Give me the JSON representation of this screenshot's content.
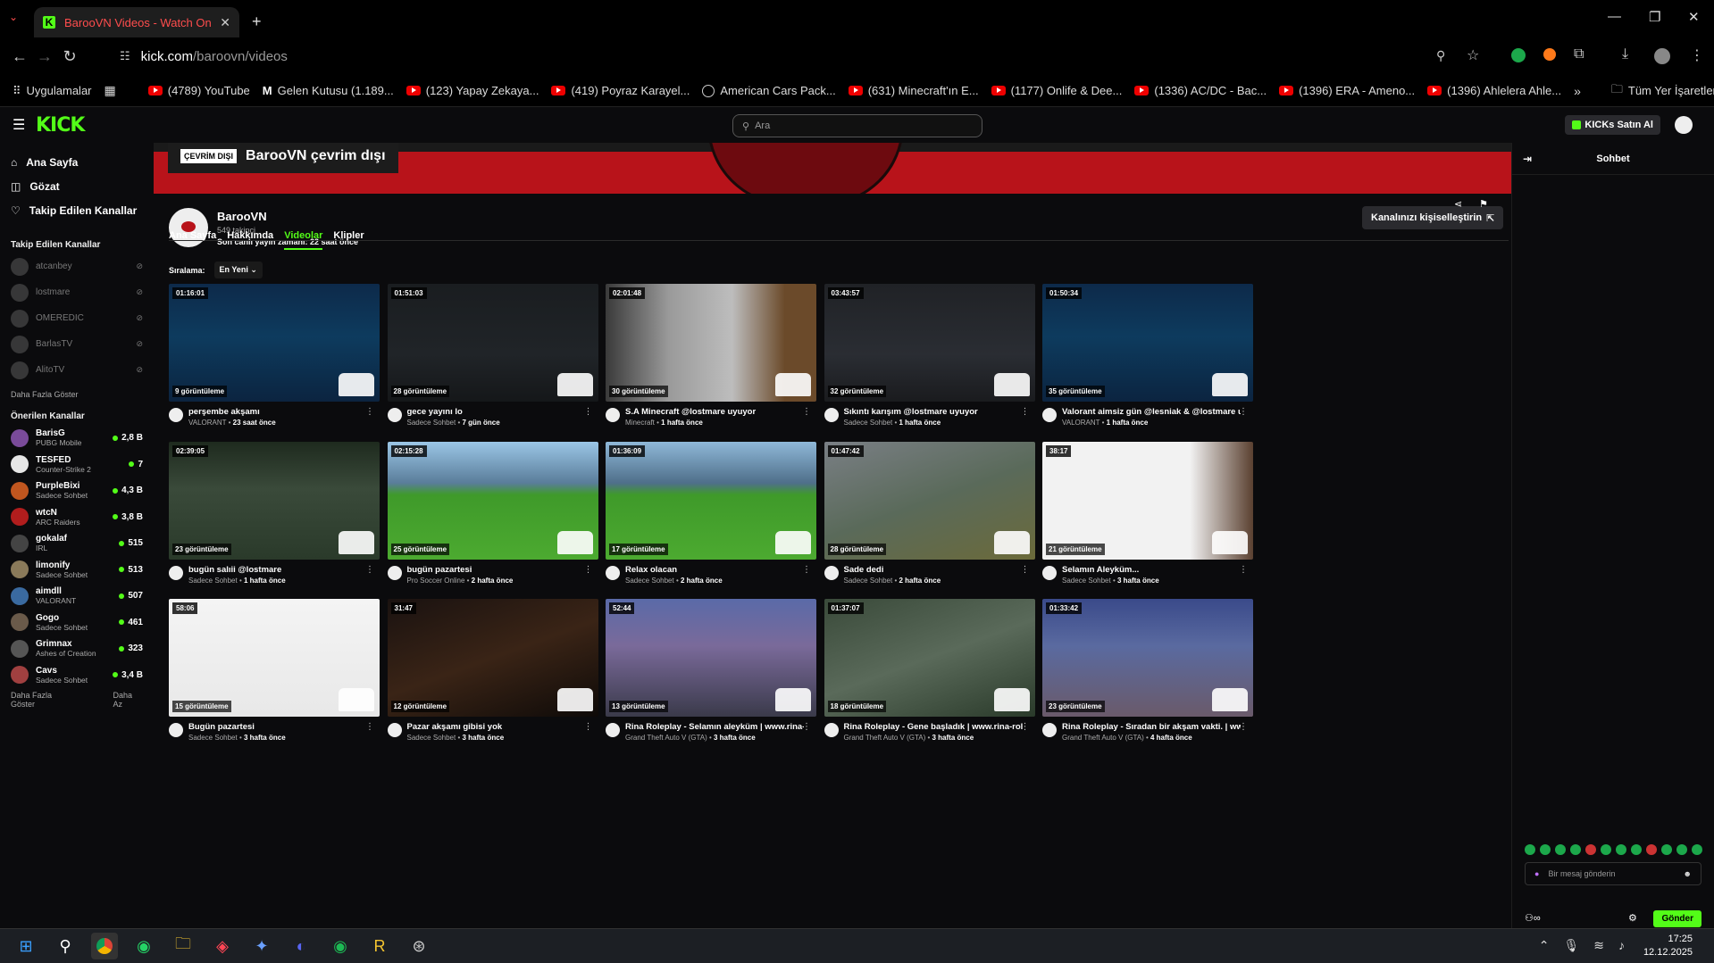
{
  "browser": {
    "tab_title": "BarooVN Videos - Watch On-D",
    "url_host": "kick.com",
    "url_path": "/baroovn/videos",
    "bookmarks": [
      {
        "label": "Uygulamalar",
        "icon": "apps-icon"
      },
      {
        "label": "(4789) YouTube",
        "icon": "youtube-icon"
      },
      {
        "label": "Gelen Kutusu (1.189...",
        "icon": "gmail-icon"
      },
      {
        "label": "(123) Yapay Zekaya...",
        "icon": "youtube-icon"
      },
      {
        "label": "(419) Poyraz Karayel...",
        "icon": "youtube-icon"
      },
      {
        "label": "American Cars Pack...",
        "icon": "site-icon"
      },
      {
        "label": "(631) Minecraft'ın E...",
        "icon": "youtube-icon"
      },
      {
        "label": "(1177) Onlife & Dee...",
        "icon": "youtube-icon"
      },
      {
        "label": "(1336) AC/DC - Bac...",
        "icon": "youtube-icon"
      },
      {
        "label": "(1396) ERA - Ameno...",
        "icon": "youtube-icon"
      },
      {
        "label": "(1396) Ahlelera Ahle...",
        "icon": "youtube-icon"
      }
    ],
    "all_bookmarks": "Tüm Yer İşaretleri"
  },
  "header": {
    "search_placeholder": "Ara",
    "buy_kicks": "KICKs Satın Al"
  },
  "sidebar": {
    "nav": [
      {
        "label": "Ana Sayfa",
        "icon": "home-icon"
      },
      {
        "label": "Gözat",
        "icon": "browse-icon"
      },
      {
        "label": "Takip Edilen Kanallar",
        "icon": "heart-icon"
      }
    ],
    "followed_title": "Takip Edilen Kanallar",
    "followed": [
      "atcanbey",
      "lostmare",
      "OMEREDIC",
      "BarlasTV",
      "AlitoTV"
    ],
    "show_more": "Daha Fazla Göster",
    "recommended_title": "Önerilen Kanallar",
    "recommended": [
      {
        "name": "BarisG",
        "category": "PUBG Mobile",
        "viewers": "2,8 B",
        "color": "#7a4b9a"
      },
      {
        "name": "TESFED",
        "category": "Counter-Strike 2",
        "viewers": "7",
        "color": "#e6e6e6"
      },
      {
        "name": "PurpleBixi",
        "category": "Sadece Sohbet",
        "viewers": "4,3 B",
        "color": "#c0561f"
      },
      {
        "name": "wtcN",
        "category": "ARC Raiders",
        "viewers": "3,8 B",
        "color": "#b11d1d"
      },
      {
        "name": "gokalaf",
        "category": "IRL",
        "viewers": "515",
        "color": "#444"
      },
      {
        "name": "limonify",
        "category": "Sadece Sohbet",
        "viewers": "513",
        "color": "#8a7a5a"
      },
      {
        "name": "aimdll",
        "category": "VALORANT",
        "viewers": "507",
        "color": "#3a6aa0"
      },
      {
        "name": "Gogo",
        "category": "Sadece Sohbet",
        "viewers": "461",
        "color": "#6a5a4a"
      },
      {
        "name": "Grimnax",
        "category": "Ashes of Creation",
        "viewers": "323",
        "color": "#555"
      },
      {
        "name": "Cavs",
        "category": "Sadece Sohbet",
        "viewers": "3,4 B",
        "color": "#a04040"
      }
    ],
    "show_more2": "Daha Fazla Göster",
    "show_less": "Daha Az"
  },
  "channel": {
    "offline_tag": "ÇEVRİM DIŞI",
    "offline_text": "BarooVN çevrim dışı",
    "name": "BarooVN",
    "followers": "549 takipçi",
    "last_live": "Son canlı yayın zamanı: 22 saat önce",
    "customize": "Kanalınızı kişiselleştirin",
    "tabs": [
      "Ana Sayfa",
      "Hakkımda",
      "Videolar",
      "Klipler"
    ],
    "sort_label": "Sıralama:",
    "sort_value": "En Yeni"
  },
  "videos": [
    {
      "duration": "01:16:01",
      "views": "9 görüntüleme",
      "title": "perşembe akşamı",
      "category": "VALORANT",
      "age": "23 saat önce",
      "bg": "linear-gradient(180deg,#0d2a4a 0%,#0d3b5e 45%,#0c2440 100%)"
    },
    {
      "duration": "01:51:03",
      "views": "28 görüntüleme",
      "title": "gece yayını lo",
      "category": "Sadece Sohbet",
      "age": "7 gün önce",
      "bg": "linear-gradient(180deg,#1a1d20 0%,#202428 60%,#151719 100%)"
    },
    {
      "duration": "02:01:48",
      "views": "30 görüntüleme",
      "title": "S.A Minecraft @lostmare uyuyor",
      "category": "Minecraft",
      "age": "1 hafta önce",
      "bg": "linear-gradient(90deg,#3a3a3a 0%,#9a9a9a 30%,#bdbdbd 60%,#6b4a2a 85%)"
    },
    {
      "duration": "03:43:57",
      "views": "32 görüntüleme",
      "title": "Sıkıntı karışım @lostmare uyuyor",
      "category": "Sadece Sohbet",
      "age": "1 hafta önce",
      "bg": "linear-gradient(180deg,#202226 0%,#2a2d33 60%,#1a1b1e 100%)"
    },
    {
      "duration": "01:50:34",
      "views": "35 görüntüleme",
      "title": "Valorant aimsiz gün @lesniak & @lostmare uyuyor",
      "category": "VALORANT",
      "age": "1 hafta önce",
      "bg": "linear-gradient(180deg,#0d2a4a 0%,#0d3b5e 45%,#0c2440 100%)"
    },
    {
      "duration": "02:39:05",
      "views": "23 görüntüleme",
      "title": "bugün salıii @lostmare",
      "category": "Sadece Sohbet",
      "age": "1 hafta önce",
      "bg": "linear-gradient(180deg,#1e2a1e 0%,#3a4a3a 40%,#2a3a2a 100%)"
    },
    {
      "duration": "02:15:28",
      "views": "25 görüntüleme",
      "title": "bugün pazartesi",
      "category": "Pro Soccer Online",
      "age": "2 hafta önce",
      "bg": "linear-gradient(180deg,#9bc6e6 0%,#5a7d9a 35%,#3f9a2a 45%,#4caa30 100%)"
    },
    {
      "duration": "01:36:09",
      "views": "17 görüntüleme",
      "title": "Relax olacan",
      "category": "Sadece Sohbet",
      "age": "2 hafta önce",
      "bg": "linear-gradient(180deg,#8fb8d8 0%,#4f6f8a 35%,#3f9a2a 45%,#4caa30 100%)"
    },
    {
      "duration": "01:47:42",
      "views": "28 görüntüleme",
      "title": "Sade dedi",
      "category": "Sadece Sohbet",
      "age": "2 hafta önce",
      "bg": "linear-gradient(160deg,#7a7f85 0%,#5a6a5a 50%,#6b6a3a 100%)"
    },
    {
      "duration": "38:17",
      "views": "21 görüntüleme",
      "title": "Selamın Aleyküm...",
      "category": "Sadece Sohbet",
      "age": "3 hafta önce",
      "bg": "linear-gradient(90deg,#f2f2f2 0%,#f2f2f2 70%,#5a4030 100%)"
    },
    {
      "duration": "58:06",
      "views": "15 görüntüleme",
      "title": "Bugün pazartesi",
      "category": "Sadece Sohbet",
      "age": "3 hafta önce",
      "bg": "linear-gradient(180deg,#f4f4f4 0%,#e8e8e8 100%)"
    },
    {
      "duration": "31:47",
      "views": "12 görüntüleme",
      "title": "Pazar akşamı gibisi yok",
      "category": "Sadece Sohbet",
      "age": "3 hafta önce",
      "bg": "linear-gradient(160deg,#1a1210 0%,#3a2416 50%,#0e0a08 100%)"
    },
    {
      "duration": "52:44",
      "views": "13 görüntüleme",
      "title": "Rina Roleplay - Selamın aleyküm | www.rina-role...",
      "category": "Grand Theft Auto V (GTA)",
      "age": "3 hafta önce",
      "bg": "linear-gradient(180deg,#5a6aa8 0%,#7a6a9a 40%,#3a3a4a 100%)"
    },
    {
      "duration": "01:37:07",
      "views": "18 görüntüleme",
      "title": "Rina Roleplay - Gene başladık | www.rina-rolepla...",
      "category": "Grand Theft Auto V (GTA)",
      "age": "3 hafta önce",
      "bg": "linear-gradient(160deg,#3a4a3a 0%,#5a6a5a 50%,#2a3a2a 100%)"
    },
    {
      "duration": "01:33:42",
      "views": "23 görüntüleme",
      "title": "Rina Roleplay - Sıradan bir akşam vakti. | www.rin...",
      "category": "Grand Theft Auto V (GTA)",
      "age": "4 hafta önce",
      "bg": "linear-gradient(180deg,#3a4a8a 0%,#5a6aa0 40%,#6a5a6a 100%)"
    }
  ],
  "chat": {
    "title": "Sohbet",
    "placeholder": "Bir mesaj gönderin",
    "send": "Gönder"
  },
  "taskbar": {
    "time": "17:25",
    "date": "12.12.2025"
  }
}
